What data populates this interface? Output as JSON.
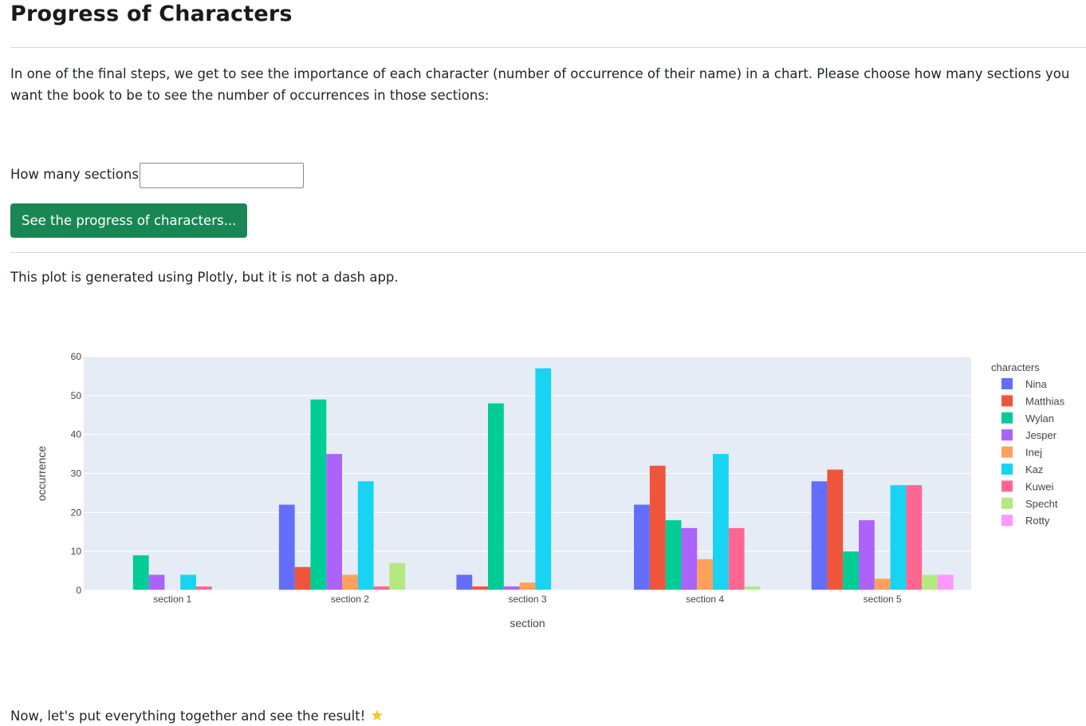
{
  "page": {
    "title": "Progress of Characters",
    "intro": "In one of the final steps, we get to see the importance of each character (number of occurrence of their name) in a chart. Please choose how many sections you want the book to be to see the number of occurrences in those sections:",
    "sections_label": "How many sections?",
    "sections_value": "",
    "button_label": "See the progress of characters...",
    "plot_note": "This plot is generated using Plotly, but it is not a dash app.",
    "final_line": "Now, let's put everything together and see the result!",
    "final_icon": "star-icon",
    "button_color": "#198754"
  },
  "chart_data": {
    "type": "bar",
    "xlabel": "section",
    "ylabel": "occurrence",
    "legend_title": "characters",
    "legend_position": "right",
    "ylim": [
      0,
      60
    ],
    "yticks": [
      0,
      10,
      20,
      30,
      40,
      50,
      60
    ],
    "grid": true,
    "background": "#e5ecf6",
    "categories": [
      "section 1",
      "section 2",
      "section 3",
      "section 4",
      "section 5"
    ],
    "series": [
      {
        "name": "Nina",
        "color": "#636efa",
        "values": [
          0,
          22,
          4,
          22,
          28
        ]
      },
      {
        "name": "Matthias",
        "color": "#ef553b",
        "values": [
          0,
          6,
          1,
          32,
          31
        ]
      },
      {
        "name": "Wylan",
        "color": "#00cc96",
        "values": [
          9,
          49,
          48,
          18,
          10
        ]
      },
      {
        "name": "Jesper",
        "color": "#ab63fa",
        "values": [
          4,
          35,
          1,
          16,
          18
        ]
      },
      {
        "name": "Inej",
        "color": "#ffa15a",
        "values": [
          0,
          4,
          2,
          8,
          3
        ]
      },
      {
        "name": "Kaz",
        "color": "#19d3f3",
        "values": [
          4,
          28,
          57,
          35,
          27
        ]
      },
      {
        "name": "Kuwei",
        "color": "#ff6692",
        "values": [
          1,
          1,
          0,
          16,
          27
        ]
      },
      {
        "name": "Specht",
        "color": "#b6e880",
        "values": [
          0,
          7,
          0,
          1,
          4
        ]
      },
      {
        "name": "Rotty",
        "color": "#ff97ff",
        "values": [
          0,
          0,
          0,
          0,
          4
        ]
      }
    ]
  }
}
